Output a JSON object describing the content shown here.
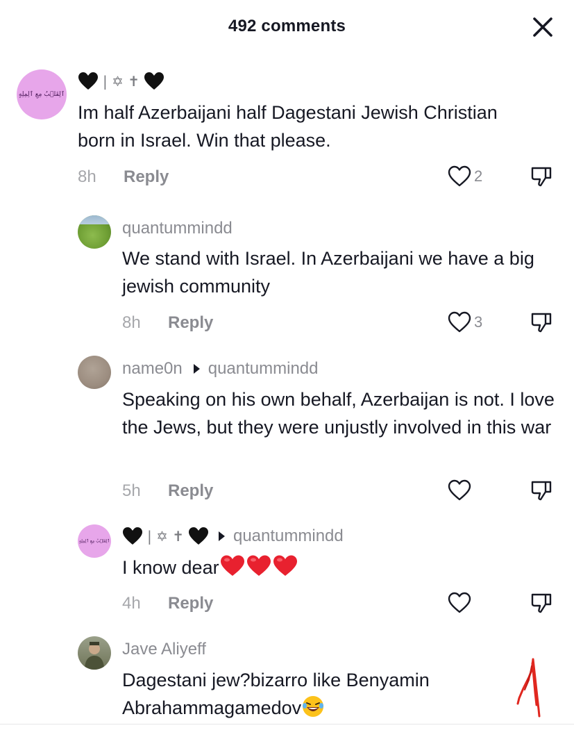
{
  "header": {
    "title": "492 comments"
  },
  "comments": [
    {
      "avatar_text": "ٱلِقَلۡبُ مِعِ ٱلِمِلِهٍ",
      "name": "🖤 ✡ ✝ 🖤",
      "text": "Im half Azerbaijani half Dagestani Jewish Christian born in Israel. Win that please.",
      "time": "8h",
      "reply_label": "Reply",
      "likes": "2"
    },
    {
      "name": "quantummindd",
      "text": "We stand with Israel. In Azerbaijani we have a big jewish community",
      "time": "8h",
      "reply_label": "Reply",
      "likes": "3"
    },
    {
      "name": "name0n",
      "reply_to": "quantummindd",
      "text": "Speaking on his own behalf, Azerbaijan is not. I love the Jews, but they were unjustly involved in this war",
      "time": "5h",
      "reply_label": "Reply",
      "likes": ""
    },
    {
      "avatar_text": "ٱلِقَلۡبُ مِعِ ٱلِمِلِهٍ",
      "name": "🖤 ✡ ✝ 🖤",
      "reply_to": "quantummindd",
      "text": "I know dear",
      "time": "4h",
      "reply_label": "Reply",
      "likes": ""
    },
    {
      "name": "Jave Aliyeff",
      "text": "Dagestani jew?bizarro like Benyamin Abrahammagamedov",
      "time": "",
      "reply_label": "",
      "likes": ""
    }
  ],
  "colors": {
    "text": "#161823",
    "secondary": "#8a8b91",
    "time": "#a6a7ab",
    "heart_red": "#e8212f",
    "avatar_pink": "#e7a6ea"
  },
  "icons": [
    "close-icon",
    "heart-outline-icon",
    "dislike-icon",
    "reply-arrow-icon",
    "red-heart-emoji",
    "laughing-emoji",
    "black-heart-emoji"
  ]
}
